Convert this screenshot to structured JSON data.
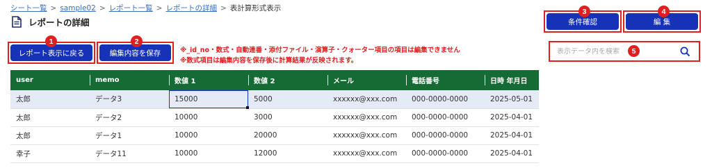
{
  "breadcrumb": {
    "items": [
      "シート一覧",
      "sample02",
      "レポート一覧",
      "レポートの詳細"
    ],
    "separator": ">",
    "current": "表計算形式表示"
  },
  "page": {
    "title": "レポートの詳細",
    "icon": "document-icon"
  },
  "buttons": {
    "back": "レポート表示に戻る",
    "save": "編集内容を保存",
    "conditions": "条件確認",
    "edit": "編 集"
  },
  "badges": [
    "1",
    "2",
    "3",
    "4",
    "5"
  ],
  "notices": [
    "※_id_no・数式・自動連番・添付ファイル・演算子・クォーター項目の項目は編集できません",
    "※数式項目は編集内容を保存後に計算結果が反映されます。"
  ],
  "search": {
    "placeholder": "表示データ内を検索",
    "icon": "search-icon"
  },
  "table": {
    "headers": [
      "user",
      "memo",
      "数値 1",
      "数値 2",
      "メール",
      "電話番号",
      "日時 年月日"
    ],
    "rows": [
      [
        "太郎",
        "データ3",
        "15000",
        "5000",
        "xxxxxx@xxx.com",
        "000-0000-0000",
        "2025-05-01"
      ],
      [
        "太郎",
        "データ2",
        "10000",
        "3000",
        "xxxxxx@xxx.com",
        "000-0000-0000",
        "2025-04-01"
      ],
      [
        "太郎",
        "データ1",
        "10000",
        "20000",
        "xxxxxx@xxx.com",
        "000-0000-0000",
        "2025-04-01"
      ],
      [
        "幸子",
        "データ11",
        "10000",
        "12000",
        "xxxxxx@xxx.com",
        "000-0000-0000",
        "2025-04-01"
      ]
    ]
  },
  "colors": {
    "button": "#1633b8",
    "header": "#166b34",
    "highlight": "#e02020",
    "link": "#3a6fc0"
  }
}
